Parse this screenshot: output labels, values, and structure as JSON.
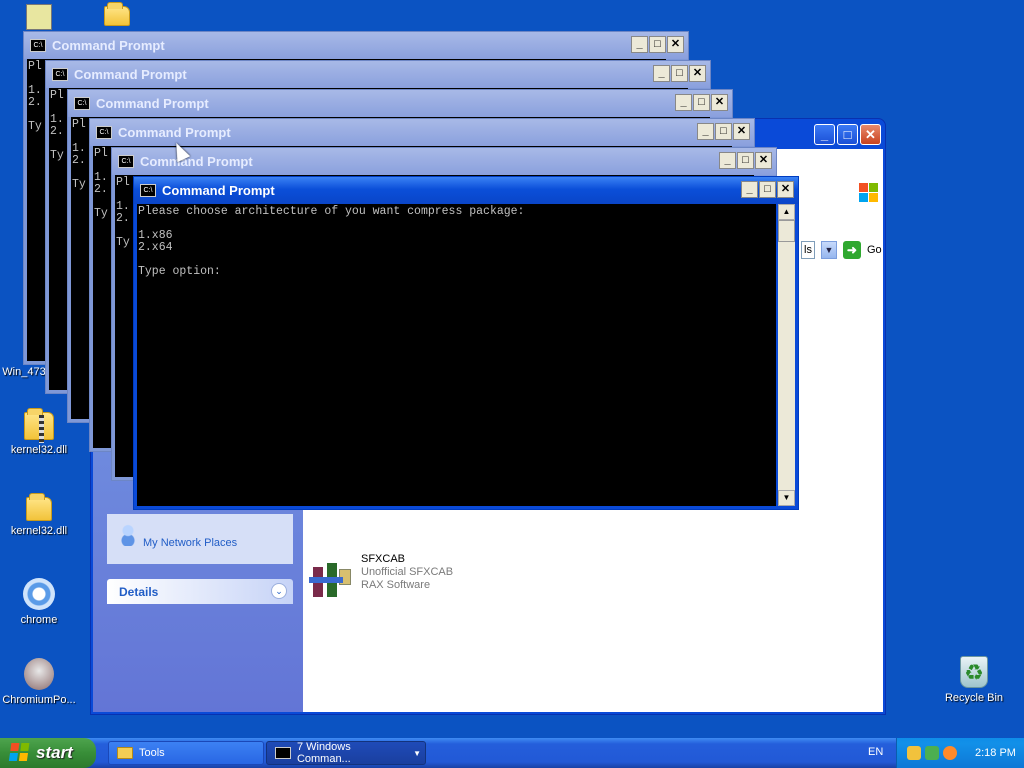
{
  "desktop": {
    "icons": [
      {
        "label": "kernel32.dll",
        "icon": "zip-folder-icon"
      },
      {
        "label": "kernel32.dll",
        "icon": "folder-icon"
      },
      {
        "label": "chrome",
        "icon": "chrome-icon"
      },
      {
        "label": "ChromiumPo...",
        "icon": "chromium-portable-icon"
      },
      {
        "label": "Recycle Bin",
        "icon": "recycle-bin-icon"
      },
      {
        "label": "Win_473",
        "icon": "partial-icon"
      }
    ]
  },
  "explorer": {
    "network_places": "My Network Places",
    "details_label": "Details",
    "address_suffix": "ls",
    "go_label": "Go",
    "item": {
      "name": "SFXCAB",
      "description": "Unofficial SFXCAB",
      "company": "RAX Software"
    }
  },
  "console": {
    "title": "Command Prompt",
    "lines": [
      "Please choose architecture of you want compress package:",
      "",
      "1.x86",
      "2.x64",
      "",
      "Type option:"
    ],
    "truncated_prefixes": [
      "Pl",
      "1.",
      "2.",
      "Ty"
    ]
  },
  "taskbar": {
    "start_label": "start",
    "tools_label": "Tools",
    "cmd_group_label": "7 Windows Comman...",
    "language": "EN",
    "clock": "2:18 PM"
  },
  "colors": {
    "desktop_bg": "#0b53c2",
    "active_title": "#0b4fd9",
    "inactive_title": "#8aa0dd",
    "start_green": "#388e38",
    "console_bg": "#000000",
    "console_text": "#c0c0c0"
  }
}
